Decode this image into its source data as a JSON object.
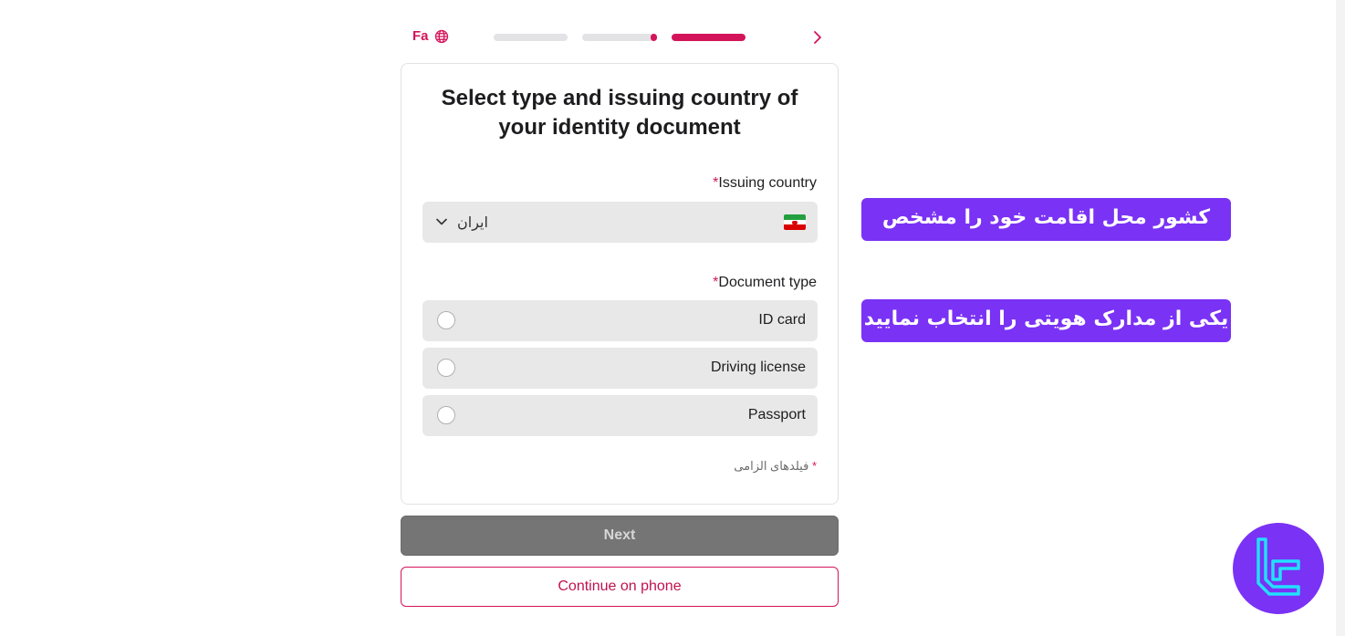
{
  "header": {
    "language_label": "Fa",
    "language_icon": "globe-icon",
    "back_icon": "chevron-right-icon",
    "progress_steps": [
      {
        "state": "pending"
      },
      {
        "state": "pending"
      },
      {
        "state": "active"
      }
    ]
  },
  "card": {
    "title": "Select type and issuing country of your identity document",
    "issuing_country": {
      "label": "Issuing country",
      "required_mark": "*",
      "selected_value": "ایران",
      "flag_icon": "iran-flag-icon",
      "chevron_icon": "chevron-down-icon"
    },
    "document_type": {
      "label": "Document type",
      "required_mark": "*",
      "options": [
        {
          "label": "ID card",
          "selected": false
        },
        {
          "label": "Driving license",
          "selected": false
        },
        {
          "label": "Passport",
          "selected": false
        }
      ]
    },
    "required_note": {
      "mark": "*",
      "text": "فیلدهای الزامی"
    }
  },
  "actions": {
    "next_label": "Next",
    "continue_phone_label": "Continue on phone"
  },
  "annotations": [
    "کشور محل اقامت خود را مشخص کنید",
    "یکی از مدارک هویتی را انتخاب نمایید"
  ],
  "colors": {
    "accent": "#d4145a",
    "annotation_bg": "#7a32f5",
    "disabled_button": "#757575",
    "field_bg": "#e8e8e8"
  },
  "logo_icon": "brand-logo-icon"
}
